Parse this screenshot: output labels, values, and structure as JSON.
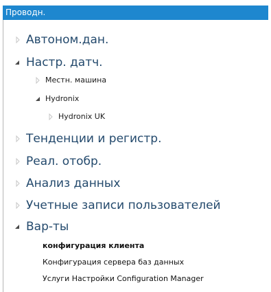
{
  "header": {
    "title": "Проводн."
  },
  "tree": {
    "avtonom": "Автоном.дан.",
    "nastr": "Настр. датч.",
    "mestn": "Местн. машина",
    "hydronix": "Hydronix",
    "hydronix_uk": "Hydronix UK",
    "tendencii": "Тенденции и регистр.",
    "real": "Реал. отобр.",
    "analiz": "Анализ данных",
    "uchetnye": "Учетные записи пользователей",
    "varty": "Вар-ты",
    "konfig_klienta": "конфигурация клиента",
    "konfig_servera": "Конфигурация сервера баз данных",
    "uslugi": "Услуги Настройки Configuration Manager"
  },
  "colors": {
    "header_bg": "#1e87cf",
    "top_level_text": "#244a6d",
    "arrow_collapsed": "#c7c7c7",
    "arrow_expanded": "#4a4a4a"
  }
}
